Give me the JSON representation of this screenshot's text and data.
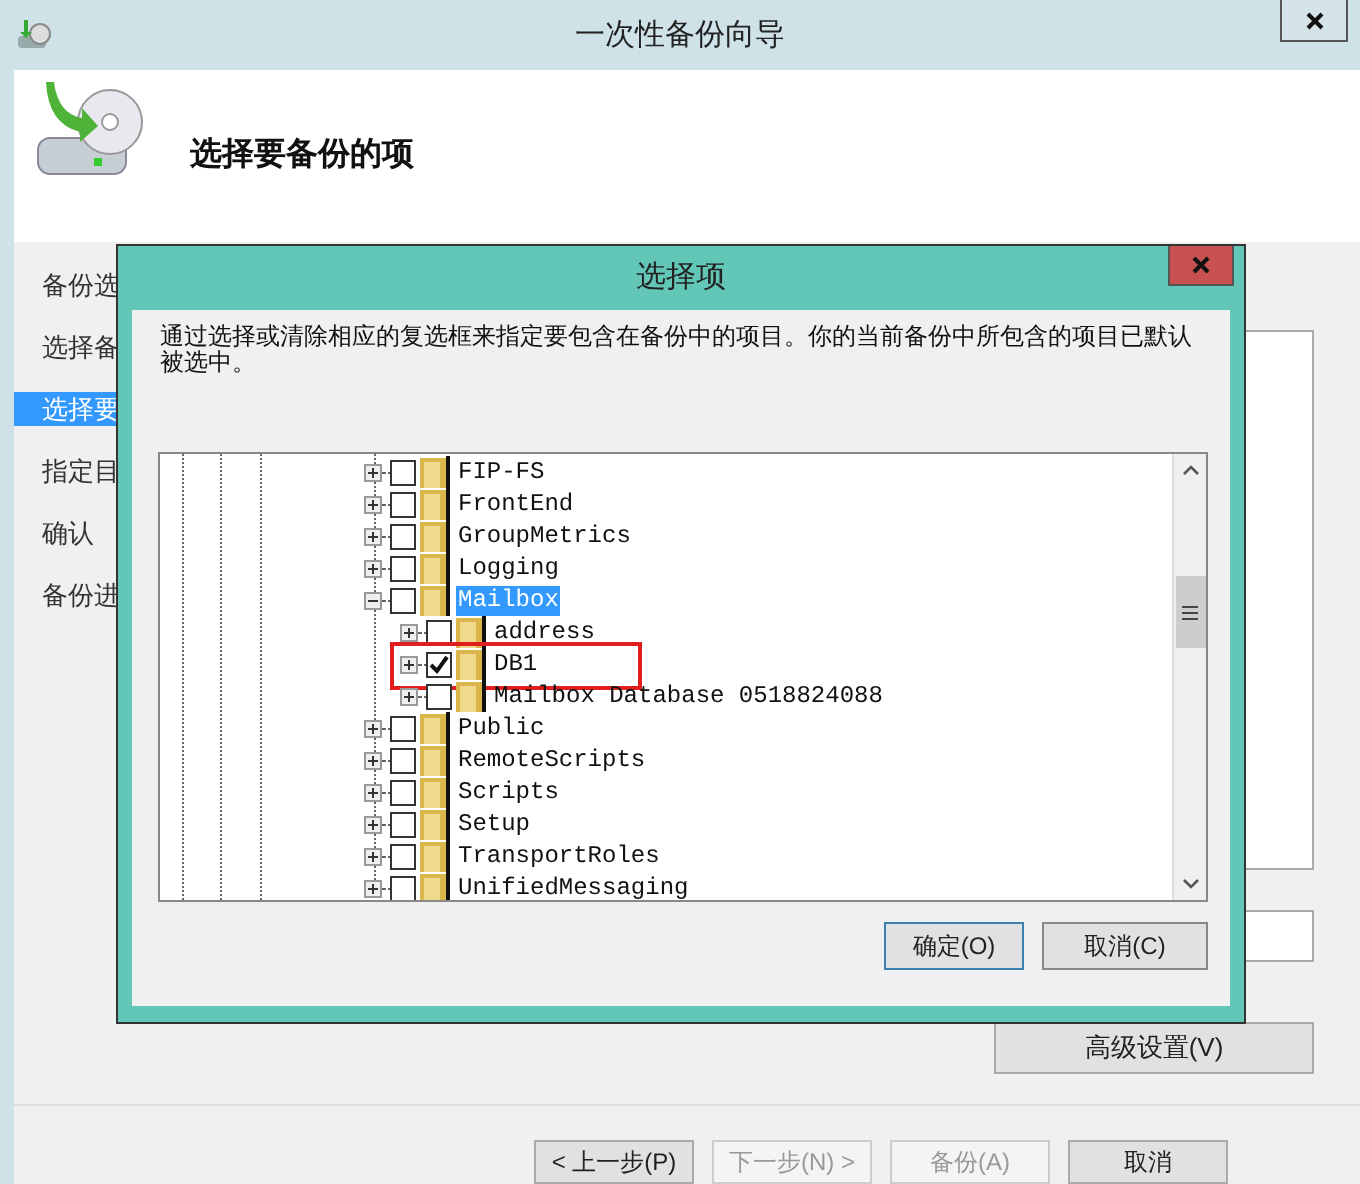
{
  "window": {
    "title": "一次性备份向导"
  },
  "header": {
    "title": "选择要备份的项"
  },
  "sidebar": {
    "items": [
      {
        "label": "备份选",
        "selected": false
      },
      {
        "label": "选择备",
        "selected": false
      },
      {
        "label": "选择要",
        "selected": true
      },
      {
        "label": "指定目",
        "selected": false
      },
      {
        "label": "确认",
        "selected": false
      },
      {
        "label": "备份进",
        "selected": false
      }
    ]
  },
  "advanced_button": {
    "label": "高级设置(V)"
  },
  "footer_buttons": [
    {
      "label": "< 上一步(P)",
      "disabled": false
    },
    {
      "label": "下一步(N) >",
      "disabled": true
    },
    {
      "label": "备份(A)",
      "disabled": true
    },
    {
      "label": "取消",
      "disabled": false
    }
  ],
  "dialog": {
    "title": "选择项",
    "description": "通过选择或清除相应的复选框来指定要包含在备份中的项目。你的当前备份中所包含的项目已默认被选中。",
    "tree": [
      {
        "label": "FIP-FS",
        "expanded": false,
        "checked": false,
        "selected": false,
        "highlighted": false
      },
      {
        "label": "FrontEnd",
        "expanded": false,
        "checked": false,
        "selected": false,
        "highlighted": false
      },
      {
        "label": "GroupMetrics",
        "expanded": false,
        "checked": false,
        "selected": false,
        "highlighted": false
      },
      {
        "label": "Logging",
        "expanded": false,
        "checked": false,
        "selected": false,
        "highlighted": false
      },
      {
        "label": "Mailbox",
        "expanded": true,
        "checked": false,
        "selected": true,
        "highlighted": false,
        "children": [
          {
            "label": "address",
            "expanded": false,
            "checked": false,
            "selected": false,
            "highlighted": false
          },
          {
            "label": "DB1",
            "expanded": false,
            "checked": true,
            "selected": false,
            "highlighted": true
          },
          {
            "label": "Mailbox Database 0518824088",
            "expanded": false,
            "checked": false,
            "selected": false,
            "highlighted": false
          }
        ]
      },
      {
        "label": "Public",
        "expanded": false,
        "checked": false,
        "selected": false,
        "highlighted": false
      },
      {
        "label": "RemoteScripts",
        "expanded": false,
        "checked": false,
        "selected": false,
        "highlighted": false
      },
      {
        "label": "Scripts",
        "expanded": false,
        "checked": false,
        "selected": false,
        "highlighted": false
      },
      {
        "label": "Setup",
        "expanded": false,
        "checked": false,
        "selected": false,
        "highlighted": false
      },
      {
        "label": "TransportRoles",
        "expanded": false,
        "checked": false,
        "selected": false,
        "highlighted": false
      },
      {
        "label": "UnifiedMessaging",
        "expanded": false,
        "checked": false,
        "selected": false,
        "highlighted": false
      }
    ],
    "buttons": [
      {
        "label": "确定(O)",
        "default": true
      },
      {
        "label": "取消(C)",
        "default": false
      }
    ]
  }
}
